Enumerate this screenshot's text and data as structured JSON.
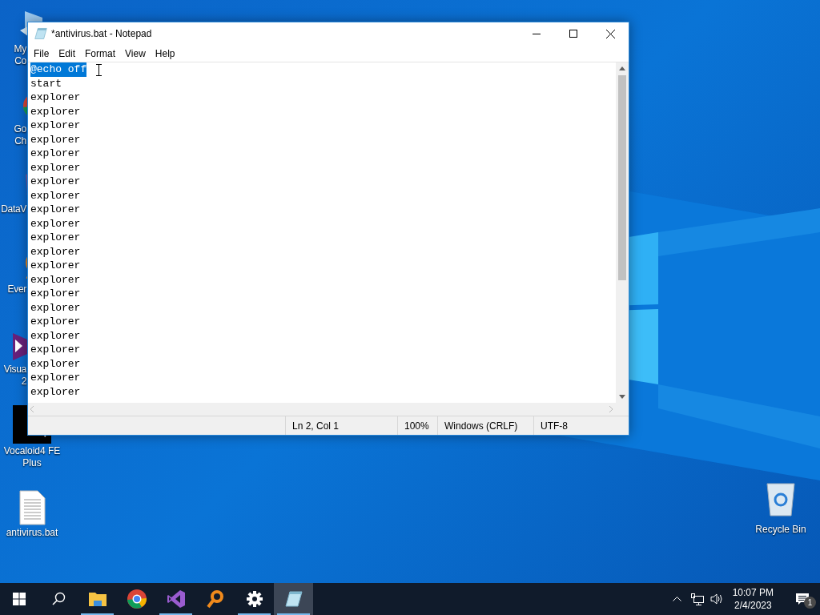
{
  "desktop_icons": [
    {
      "label": "My Co",
      "kind": "computer"
    },
    {
      "label": "Go\nCh",
      "kind": "chrome"
    },
    {
      "label": "DataV",
      "kind": "data"
    },
    {
      "label": "Ever",
      "kind": "everything"
    },
    {
      "label": "Visua\n2",
      "kind": "vs"
    },
    {
      "label": "Vocaloid4 FE\nPlus",
      "kind": "vocaloid"
    },
    {
      "label": "antivirus.bat",
      "kind": "file"
    }
  ],
  "recycle_bin": {
    "label": "Recycle Bin"
  },
  "window": {
    "title": "*antivirus.bat - Notepad",
    "menu": [
      "File",
      "Edit",
      "Format",
      "View",
      "Help"
    ],
    "lines": [
      {
        "text": "@echo off",
        "selected": true
      },
      {
        "text": "start",
        "selected": false
      },
      {
        "text": "explorer",
        "selected": false
      },
      {
        "text": "explorer",
        "selected": false
      },
      {
        "text": "explorer",
        "selected": false
      },
      {
        "text": "explorer",
        "selected": false
      },
      {
        "text": "explorer",
        "selected": false
      },
      {
        "text": "explorer",
        "selected": false
      },
      {
        "text": "explorer",
        "selected": false
      },
      {
        "text": "explorer",
        "selected": false
      },
      {
        "text": "explorer",
        "selected": false
      },
      {
        "text": "explorer",
        "selected": false
      },
      {
        "text": "explorer",
        "selected": false
      },
      {
        "text": "explorer",
        "selected": false
      },
      {
        "text": "explorer",
        "selected": false
      },
      {
        "text": "explorer",
        "selected": false
      },
      {
        "text": "explorer",
        "selected": false
      },
      {
        "text": "explorer",
        "selected": false
      },
      {
        "text": "explorer",
        "selected": false
      },
      {
        "text": "explorer",
        "selected": false
      },
      {
        "text": "explorer",
        "selected": false
      },
      {
        "text": "explorer",
        "selected": false
      },
      {
        "text": "explorer",
        "selected": false
      },
      {
        "text": "explorer",
        "selected": false
      }
    ],
    "status": [
      "Ln 2, Col 1",
      "100%",
      "Windows (CRLF)",
      "UTF-8"
    ]
  },
  "taskbar": {
    "items": [
      {
        "kind": "search",
        "running": false,
        "active": false
      },
      {
        "kind": "folder",
        "running": true,
        "active": false
      },
      {
        "kind": "chrome",
        "running": false,
        "active": false
      },
      {
        "kind": "vs",
        "running": true,
        "active": false
      },
      {
        "kind": "magnifier",
        "running": false,
        "active": false
      },
      {
        "kind": "gear",
        "running": true,
        "active": false
      },
      {
        "kind": "notepad",
        "running": true,
        "active": true
      }
    ],
    "time": "10:07 PM",
    "date": "2/4/2023",
    "notifications": "1"
  }
}
